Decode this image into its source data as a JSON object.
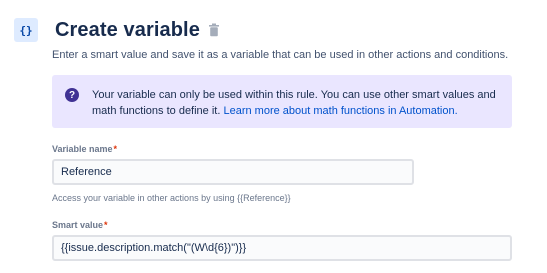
{
  "header": {
    "icon": "braces-icon",
    "title": "Create variable",
    "delete_icon": "trash-icon"
  },
  "subtitle": "Enter a smart value and save it as a variable that can be used in other actions and conditions.",
  "info": {
    "icon": "question-circle-icon",
    "text": "Your variable can only be used within this rule. You can use other smart values and math functions to define it. ",
    "link": "Learn more about math functions in Automation."
  },
  "variable_name": {
    "label": "Variable name",
    "required_marker": "*",
    "value": "Reference",
    "helper": "Access your variable in other actions by using {{Reference}}"
  },
  "smart_value": {
    "label": "Smart value",
    "required_marker": "*",
    "value": "{{issue.description.match(\"(W\\d{6})\")}}"
  },
  "colors": {
    "info_background": "#eae6ff",
    "info_icon": "#403294",
    "link": "#0052cc",
    "required": "#de350b"
  }
}
